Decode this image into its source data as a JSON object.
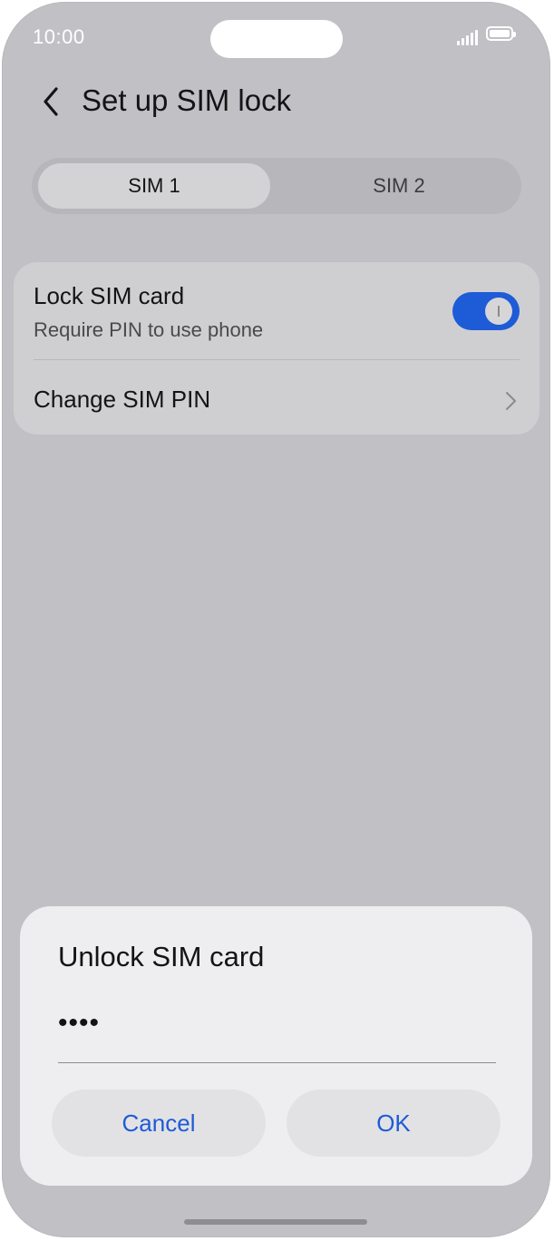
{
  "status_bar": {
    "time": "10:00"
  },
  "header": {
    "title": "Set up SIM lock"
  },
  "tabs": [
    {
      "label": "SIM 1",
      "selected": true
    },
    {
      "label": "SIM 2",
      "selected": false
    }
  ],
  "settings": {
    "lock_sim": {
      "title": "Lock SIM card",
      "subtitle": "Require PIN to use phone",
      "enabled": true
    },
    "change_pin": {
      "title": "Change SIM PIN"
    }
  },
  "dialog": {
    "title": "Unlock SIM card",
    "pin_value": "••••",
    "cancel_label": "Cancel",
    "ok_label": "OK"
  },
  "colors": {
    "accent": "#1e5bd6",
    "background": "#c1c0c5",
    "dialog": "#eeeef0"
  }
}
